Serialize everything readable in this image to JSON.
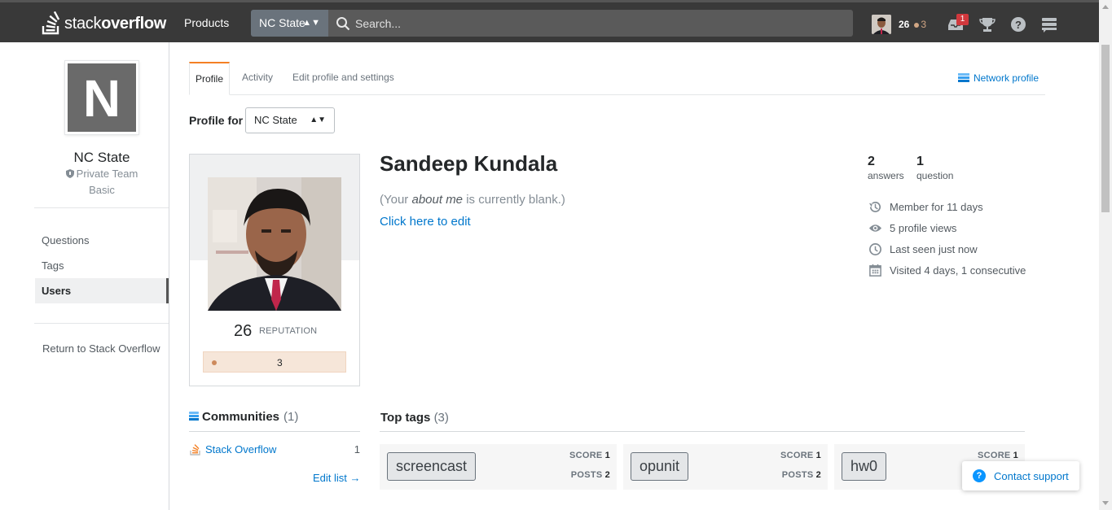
{
  "topbar": {
    "logo_light": "stack",
    "logo_bold": "overflow",
    "products_label": "Products",
    "team_select": "NC State",
    "search_placeholder": "Search...",
    "reputation": "26",
    "bronze_badges": "3",
    "inbox_count": "1"
  },
  "sidebar": {
    "team_initial": "N",
    "team_name": "NC State",
    "team_type": "Private Team",
    "plan": "Basic",
    "nav": [
      "Questions",
      "Tags",
      "Users"
    ],
    "return_link": "Return to Stack Overflow"
  },
  "tabs": {
    "items": [
      "Profile",
      "Activity",
      "Edit profile and settings"
    ],
    "network_profile": "Network profile"
  },
  "profile_for": {
    "label": "Profile for",
    "value": "NC State"
  },
  "card": {
    "reputation": "26",
    "reputation_label": "REPUTATION",
    "bronze_count": "3"
  },
  "user": {
    "name": "Sandeep Kundala",
    "about_pre": "(Your ",
    "about_italic": "about me",
    "about_post": " is currently blank.)",
    "edit_link": "Click here to edit"
  },
  "stats": {
    "answers_num": "2",
    "answers_label": "answers",
    "questions_num": "1",
    "questions_label": "question"
  },
  "meta": [
    "Member for 11 days",
    "5 profile views",
    "Last seen just now",
    "Visited 4 days, 1 consecutive"
  ],
  "communities": {
    "heading": "Communities",
    "count": "(1)",
    "items": [
      {
        "name": "Stack Overflow",
        "num": "1"
      }
    ],
    "edit_list": "Edit list →"
  },
  "top_tags": {
    "heading": "Top tags",
    "count": "(3)",
    "score_label": "SCORE",
    "posts_label": "POSTS",
    "tags": [
      {
        "name": "screencast",
        "score": "1",
        "posts": "2"
      },
      {
        "name": "opunit",
        "score": "1",
        "posts": "2"
      },
      {
        "name": "hw0",
        "score": "1",
        "posts": ""
      }
    ]
  },
  "contact_support": "Contact support",
  "colors": {
    "topbar": "#393939",
    "link": "#0077cc",
    "accent": "#f48024",
    "bronze": "#cd8a5c"
  }
}
